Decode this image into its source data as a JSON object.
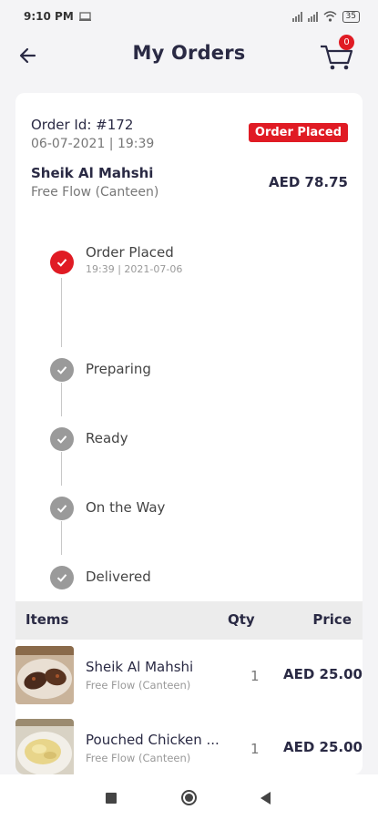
{
  "status_bar": {
    "time": "9:10 PM",
    "battery": "35"
  },
  "header": {
    "title": "My Orders",
    "cart_count": "0"
  },
  "order": {
    "id_label": "Order Id: #172",
    "date": "06-07-2021 | 19:39",
    "status": "Order Placed",
    "restaurant": "Sheik Al Mahshi",
    "location": "Free Flow (Canteen)",
    "total": "AED 78.75"
  },
  "timeline": [
    {
      "label": "Order Placed",
      "time": "19:39 | 2021-07-06",
      "active": true
    },
    {
      "label": "Preparing",
      "active": false
    },
    {
      "label": "Ready",
      "active": false
    },
    {
      "label": "On the Way",
      "active": false
    },
    {
      "label": "Delivered",
      "active": false
    }
  ],
  "items_table": {
    "headers": {
      "items": "Items",
      "qty": "Qty",
      "price": "Price"
    },
    "rows": [
      {
        "name": "Sheik Al Mahshi",
        "location": "Free Flow (Canteen)",
        "qty": "1",
        "price": "AED 25.00"
      },
      {
        "name": "Pouched Chicken ...",
        "location": "Free Flow (Canteen)",
        "qty": "1",
        "price": "AED 25.00"
      }
    ]
  },
  "colors": {
    "accent": "#e01b24",
    "pending": "#9a9a9a",
    "text": "#2a2a44"
  }
}
